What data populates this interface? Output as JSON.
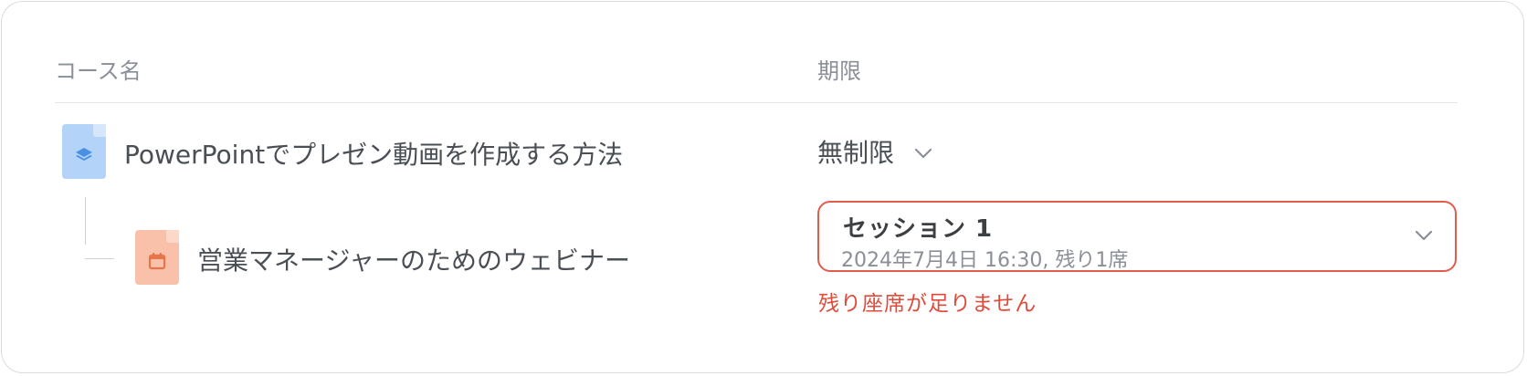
{
  "header": {
    "course_name_label": "コース名",
    "deadline_label": "期限"
  },
  "course": {
    "title": "PowerPointでプレゼン動画を作成する方法",
    "icon": "course-stack-icon",
    "icon_color": "#b3d3f8",
    "deadline": {
      "value": "無制限"
    }
  },
  "webinar": {
    "title": "営業マネージャーのためのウェビナー",
    "icon": "calendar-icon",
    "icon_color": "#f9c1a9",
    "session": {
      "name": "セッション 1",
      "detail": "2024年7月4日 16:30, 残り1席"
    },
    "error": "残り座席が足りません",
    "error_color": "#e04b3b"
  }
}
